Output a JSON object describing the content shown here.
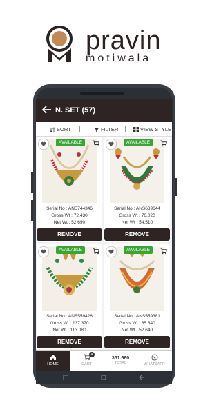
{
  "brand": {
    "name": "pravin",
    "sub": "motiwala"
  },
  "appbar": {
    "title": "N. SET (57)"
  },
  "toolbar": {
    "sort": "SORT",
    "filter": "FILTER",
    "view": "VIEW STYLE"
  },
  "products": [
    {
      "badge": "AVAILABLE",
      "serial": "Serial No : ANS744346",
      "gross": "Gross Wt : 72.430",
      "net": "Net Wt : 52.690",
      "remove": "REMOVE"
    },
    {
      "badge": "AVAILABLE",
      "serial": "Serial No : ANS639644",
      "gross": "Gross Wt : 76.020",
      "net": "Net Wt : 54.510",
      "remove": "REMOVE"
    },
    {
      "badge": "AVAILABLE",
      "serial": "Serial No : ANS559426",
      "gross": "Gross Wt : 137.370",
      "net": "Net Wt : 113.080",
      "remove": "REMOVE"
    },
    {
      "badge": "AVAILABLE",
      "serial": "Serial No : ANS559381",
      "gross": "Gross Wt : 65.840",
      "net": "Net Wt : 52.640",
      "remove": "REMOVE"
    }
  ],
  "nav": {
    "home": "HOME",
    "cart": "CART",
    "cart_count": "4",
    "total_value": "351.660",
    "total": "TOTAL",
    "whatsapp": "WHATSAPP"
  },
  "colors": {
    "primary": "#2e2423",
    "available": "#39a535"
  },
  "icons": [
    "back-arrow-icon",
    "sort-icon",
    "filter-icon",
    "grid-icon",
    "heart-icon",
    "cart-icon",
    "home-icon",
    "whatsapp-icon"
  ]
}
